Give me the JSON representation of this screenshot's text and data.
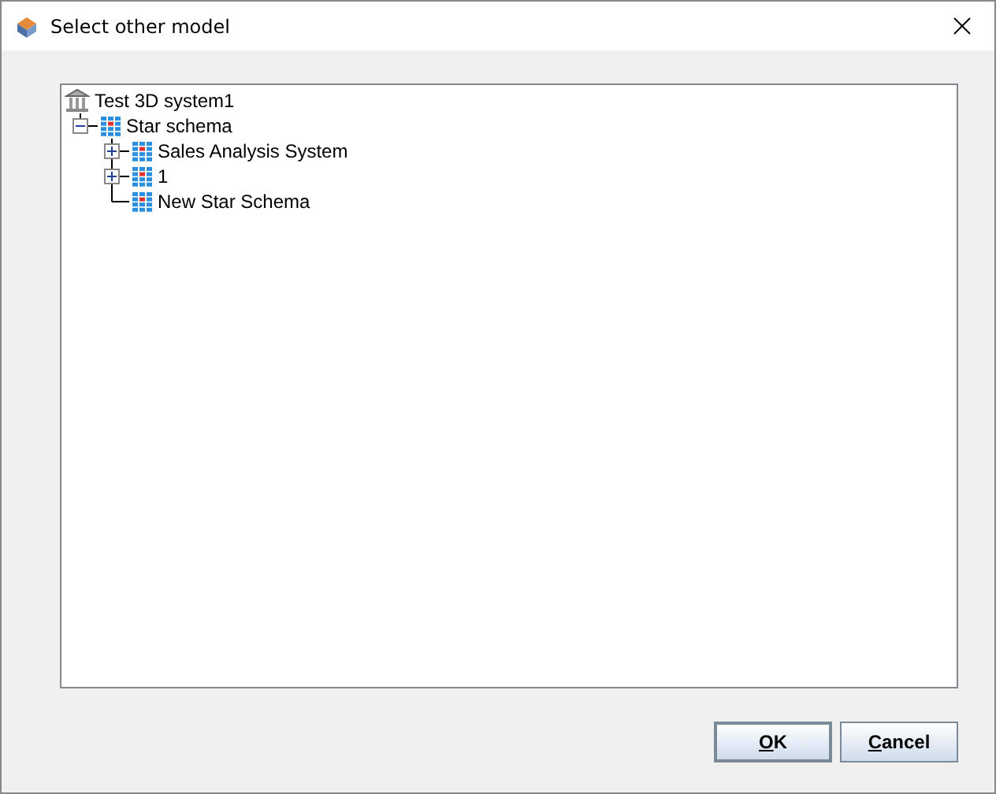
{
  "window": {
    "title": "Select other model"
  },
  "tree": [
    {
      "label": "Test 3D system1",
      "kind": "database",
      "children": [
        {
          "label": "Star schema",
          "kind": "schema",
          "expanded": true,
          "children": [
            {
              "label": "Sales Analysis System",
              "kind": "schema",
              "expanded": false
            },
            {
              "label": "1",
              "kind": "schema",
              "expanded": false
            },
            {
              "label": "New Star Schema",
              "kind": "schema"
            }
          ]
        }
      ]
    }
  ],
  "buttons": [
    {
      "label": "OK",
      "default": true
    },
    {
      "label": "Cancel",
      "default": false
    }
  ]
}
